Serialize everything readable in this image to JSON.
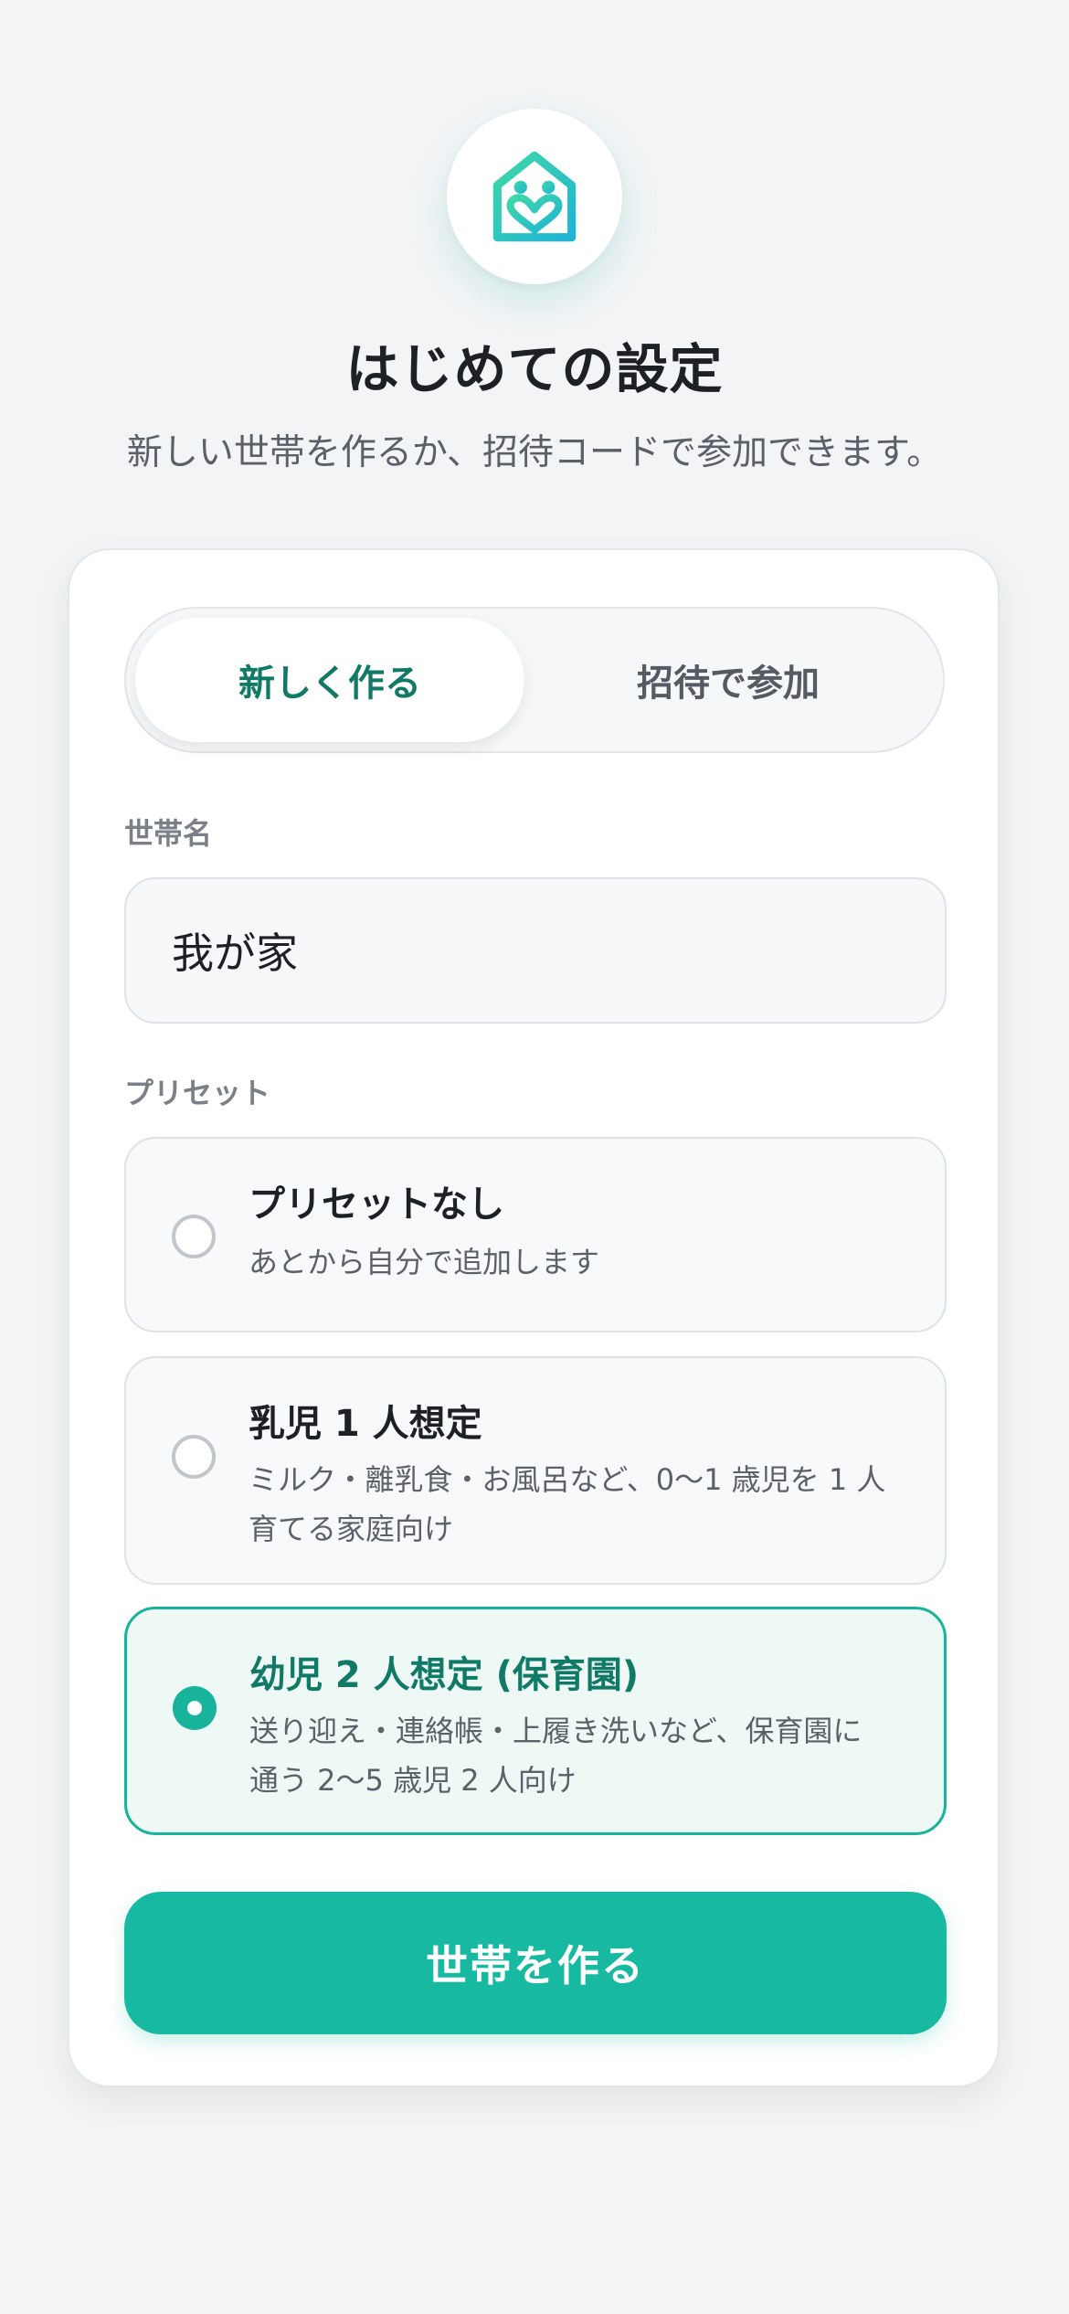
{
  "header": {
    "logo_icon": "house-heart-icon",
    "title": "はじめての設定",
    "subtitle": "新しい世帯を作るか、招待コードで参加できます。"
  },
  "tabs": [
    {
      "label": "新しく作る",
      "active": true
    },
    {
      "label": "招待で参加",
      "active": false
    }
  ],
  "household": {
    "label": "世帯名",
    "value": "我が家"
  },
  "preset": {
    "label": "プリセット",
    "options": [
      {
        "title": "プリセットなし",
        "description": "あとから自分で追加します",
        "selected": false
      },
      {
        "title": "乳児 1 人想定",
        "description": "ミルク・離乳食・お風呂など、0〜1 歳児を 1 人育てる家庭向け",
        "selected": false
      },
      {
        "title": "幼児 2 人想定 (保育園)",
        "description": "送り迎え・連絡帳・上履き洗いなど、保育園に通う 2〜5 歳児 2 人向け",
        "selected": true
      }
    ]
  },
  "submit_label": "世帯を作る",
  "colors": {
    "accent": "#17b9a0",
    "accent_dark": "#107a66",
    "background": "#f3f4f6"
  }
}
